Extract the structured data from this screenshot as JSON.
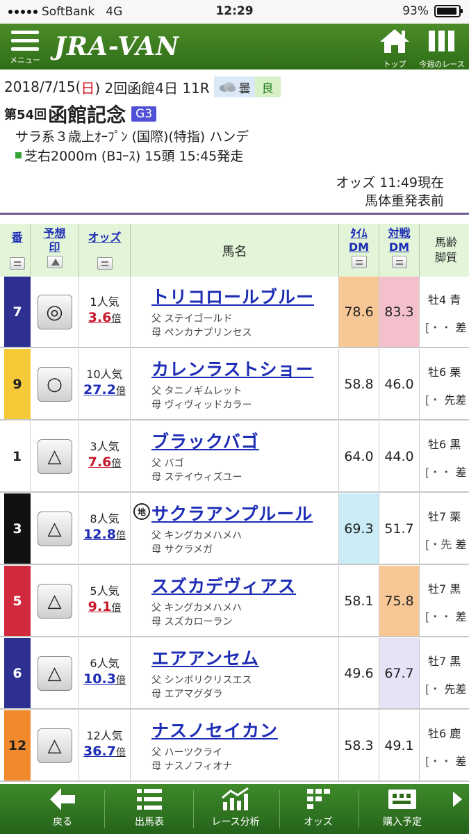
{
  "status_bar": {
    "carrier": "SoftBank",
    "network": "4G",
    "time": "12:29",
    "battery": "93%",
    "battery_level": 0.93
  },
  "header": {
    "menu_label": "メニュー",
    "logo": "JRA-VAN",
    "top_label": "トップ",
    "week_label": "今週のレース"
  },
  "race": {
    "date_prefix": "2018/7/15(",
    "weekday": "日",
    "date_suffix": ") 2回函館4日 11R",
    "weather": "曇",
    "track_condition": "良",
    "number": "第54回",
    "name": "函館記念",
    "grade": "G3",
    "conditions": "サラ系３歳上ｵｰﾌﾟﾝ (国際)(特指) ハンデ",
    "course": "芝右2000m (Bｺｰｽ) 15頭 15:45発走",
    "odds_time": "オッズ 11:49現在",
    "weight_status": "馬体重発表前"
  },
  "table_headers": {
    "num": "番",
    "mark_l1": "予想",
    "mark_l2": "印",
    "odds": "オッズ",
    "name": "馬名",
    "tdm_l1": "ﾀｲﾑ",
    "tdm_l2": "DM",
    "vdm_l1": "対戦",
    "vdm_l2": "DM",
    "age_l1": "馬齢",
    "age_l2": "脚質"
  },
  "horses": [
    {
      "num": "7",
      "mark": "◎",
      "popularity": "1人気",
      "odds": "3.6",
      "odds_color": "red",
      "bai": "倍",
      "name": "トリコロールブルー",
      "chiho": "",
      "sire": "父 ステイゴールド",
      "dam": "母 ペンカナプリンセス",
      "time_dm": "78.6",
      "vs_dm": "83.3",
      "age": "牡4 青",
      "style_prefix": "[・・",
      "style": "差",
      "bg": "#2d2f91",
      "fg": "#ffffff",
      "tdm_bg": "#f7c896",
      "vdm_bg": "#f4c0cc"
    },
    {
      "num": "9",
      "mark": "○",
      "popularity": "10人気",
      "odds": "27.2",
      "odds_color": "blue",
      "bai": "倍",
      "name": "カレンラストショー",
      "chiho": "",
      "sire": "父 タニノギムレット",
      "dam": "母 ヴィヴィッドカラー",
      "time_dm": "58.8",
      "vs_dm": "46.0",
      "age": "牡6 栗",
      "style_prefix": "[・",
      "style": "先差",
      "bg": "#f5c937",
      "fg": "#222222",
      "tdm_bg": "#ffffff",
      "vdm_bg": "#ffffff"
    },
    {
      "num": "1",
      "mark": "△",
      "popularity": "3人気",
      "odds": "7.6",
      "odds_color": "red",
      "bai": "倍",
      "name": "ブラックバゴ",
      "chiho": "",
      "sire": "父 バゴ",
      "dam": "母 ステイウィズユー",
      "time_dm": "64.0",
      "vs_dm": "44.0",
      "age": "牡6 黒",
      "style_prefix": "[・・",
      "style": "差",
      "bg": "#ffffff",
      "fg": "#222222",
      "tdm_bg": "#ffffff",
      "vdm_bg": "#ffffff"
    },
    {
      "num": "3",
      "mark": "△",
      "popularity": "8人気",
      "odds": "12.8",
      "odds_color": "blue",
      "bai": "倍",
      "name": "サクラアンプルール",
      "chiho": "地",
      "sire": "父 キングカメハメハ",
      "dam": "母 サクラメガ",
      "time_dm": "69.3",
      "vs_dm": "51.7",
      "age": "牡7 栗",
      "style_prefix": "[・先",
      "style": "差",
      "bg": "#111111",
      "fg": "#ffffff",
      "tdm_bg": "#c9ecf7",
      "vdm_bg": "#ffffff"
    },
    {
      "num": "5",
      "mark": "△",
      "popularity": "5人気",
      "odds": "9.1",
      "odds_color": "red",
      "bai": "倍",
      "name": "スズカデヴィアス",
      "chiho": "",
      "sire": "父 キングカメハメハ",
      "dam": "母 スズカローラン",
      "time_dm": "58.1",
      "vs_dm": "75.8",
      "age": "牡7 黒",
      "style_prefix": "[・・",
      "style": "差",
      "bg": "#d12a3c",
      "fg": "#ffffff",
      "tdm_bg": "#ffffff",
      "vdm_bg": "#f7c896"
    },
    {
      "num": "6",
      "mark": "△",
      "popularity": "6人気",
      "odds": "10.3",
      "odds_color": "blue",
      "bai": "倍",
      "name": "エアアンセム",
      "chiho": "",
      "sire": "父 シンボリクリスエス",
      "dam": "母 エアマグダラ",
      "time_dm": "49.6",
      "vs_dm": "67.7",
      "age": "牡7 黒",
      "style_prefix": "[・",
      "style": "先差",
      "bg": "#2d2f91",
      "fg": "#ffffff",
      "tdm_bg": "#ffffff",
      "vdm_bg": "#e6e3f6"
    },
    {
      "num": "12",
      "mark": "△",
      "popularity": "12人気",
      "odds": "36.7",
      "odds_color": "blue",
      "bai": "倍",
      "name": "ナスノセイカン",
      "chiho": "",
      "sire": "父 ハーツクライ",
      "dam": "母 ナスノフィオナ",
      "time_dm": "58.3",
      "vs_dm": "49.1",
      "age": "牡6 鹿",
      "style_prefix": "[・・",
      "style": "差",
      "bg": "#f08a2c",
      "fg": "#222222",
      "tdm_bg": "#ffffff",
      "vdm_bg": "#ffffff"
    }
  ],
  "bottom_nav": {
    "back": "戻る",
    "entries": "出馬表",
    "analysis": "レース分析",
    "odds": "オッズ",
    "purchase": "購入予定"
  },
  "colors": {
    "header_green": "#3a7d20",
    "link_blue": "#1d2cb4",
    "odds_red": "#c8182d",
    "grade_bg": "#5151d8"
  }
}
